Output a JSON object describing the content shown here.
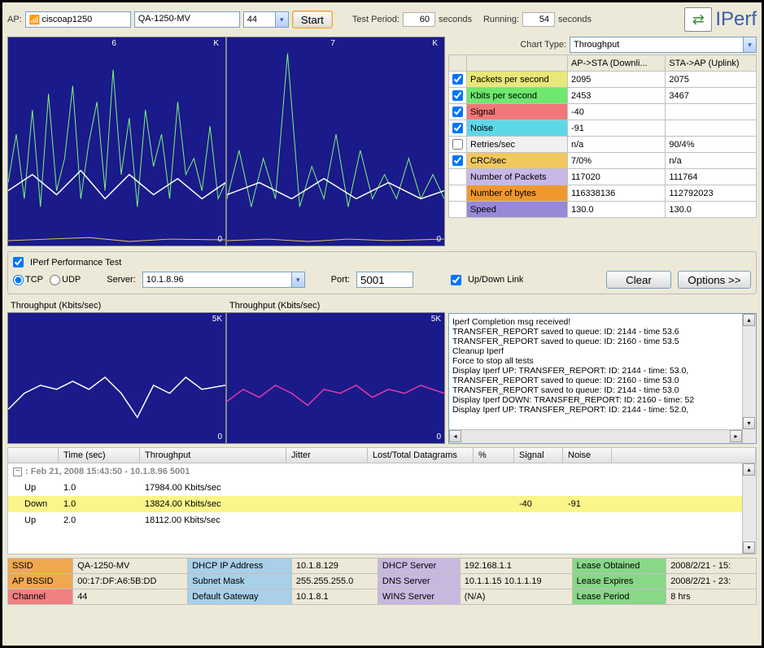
{
  "top": {
    "ap_label": "AP:",
    "ap_name": "ciscoap1250",
    "ap_ssid": "QA-1250-MV",
    "channel": "44",
    "start_btn": "Start",
    "test_period_label": "Test Period:",
    "test_period": "60",
    "seconds1": "seconds",
    "running_label": "Running:",
    "running": "54",
    "seconds2": "seconds",
    "logo": "IPerf"
  },
  "charts": {
    "main1": {
      "top": "6",
      "unit": "K",
      "bottom": "0"
    },
    "main2": {
      "top": "7",
      "unit": "K",
      "bottom": "0"
    }
  },
  "chart_type_label": "Chart Type:",
  "chart_type_value": "Throughput",
  "metrics": {
    "col1": "AP->STA (Downli...",
    "col2": "STA->AP (Uplink)",
    "rows": [
      {
        "chk": true,
        "label": "Packets per second",
        "v1": "2095",
        "v2": "2075"
      },
      {
        "chk": true,
        "label": "Kbits per second",
        "v1": "2453",
        "v2": "3467"
      },
      {
        "chk": true,
        "label": "Signal",
        "v1": "-40",
        "v2": ""
      },
      {
        "chk": true,
        "label": "Noise",
        "v1": "-91",
        "v2": ""
      },
      {
        "chk": false,
        "label": "Retries/sec",
        "v1": "n/a",
        "v2": "90/4%"
      },
      {
        "chk": true,
        "label": "CRC/sec",
        "v1": "7/0%",
        "v2": "n/a"
      },
      {
        "chk": null,
        "label": "Number of Packets",
        "v1": "117020",
        "v2": "111764"
      },
      {
        "chk": null,
        "label": "Number of bytes",
        "v1": "116338136",
        "v2": "112792023"
      },
      {
        "chk": null,
        "label": "Speed",
        "v1": "130.0",
        "v2": "130.0"
      }
    ]
  },
  "iperf": {
    "test_label": "IPerf Performance Test",
    "tcp": "TCP",
    "udp": "UDP",
    "server_label": "Server:",
    "server": "10.1.8.96",
    "port_label": "Port:",
    "port": "5001",
    "updown": "Up/Down Link",
    "clear": "Clear",
    "options": "Options >>"
  },
  "tp": {
    "label1": "Throughput (Kbits/sec)",
    "label2": "Throughput (Kbits/sec)",
    "max": "5K",
    "min": "0"
  },
  "log": {
    "lines": [
      "Iperf Completion msg received!",
      "TRANSFER_REPORT saved to queue: ID: 2144 - time 53.6",
      "TRANSFER_REPORT saved to queue: ID: 2160 - time 53.5",
      "Cleanup Iperf",
      "Force to stop all tests",
      "Display Iperf UP: TRANSFER_REPORT: ID: 2144 - time: 53.0,",
      "TRANSFER_REPORT saved to queue: ID: 2160 - time 53.0",
      "TRANSFER_REPORT saved to queue: ID: 2144 - time 53.0",
      "Display Iperf DOWN: TRANSFER_REPORT: ID: 2160 - time: 52",
      "Display Iperf UP: TRANSFER_REPORT: ID: 2144 - time: 52.0,"
    ]
  },
  "cols": [
    "",
    "Time (sec)",
    "Throughput",
    "Jitter",
    "Lost/Total Datagrams",
    "%",
    "Signal",
    "Noise",
    ""
  ],
  "session": ": Feb 21, 2008 15:43:50 - 10.1.8.96 5001",
  "results": [
    {
      "dir": "Up",
      "time": "1.0",
      "tp": "17984.00 Kbits/sec",
      "sig": "",
      "noise": ""
    },
    {
      "dir": "Down",
      "time": "1.0",
      "tp": "13824.00 Kbits/sec",
      "sig": "-40",
      "noise": "-91"
    },
    {
      "dir": "Up",
      "time": "2.0",
      "tp": "18112.00 Kbits/sec",
      "sig": "",
      "noise": ""
    }
  ],
  "info": {
    "r1": [
      "SSID",
      "QA-1250-MV",
      "DHCP IP Address",
      "10.1.8.129",
      "DHCP Server",
      "192.168.1.1",
      "Lease Obtained",
      "2008/2/21 - 15:"
    ],
    "r2": [
      "AP BSSID",
      "00:17:DF:A6:5B:DD",
      "Subnet Mask",
      "255.255.255.0",
      "DNS Server",
      "10.1.1.15 10.1.1.19",
      "Lease Expires",
      "2008/2/21 - 23:"
    ],
    "r3": [
      "Channel",
      "44",
      "Default Gateway",
      "10.1.8.1",
      "WINS Server",
      "(N/A)",
      "Lease Period",
      "8 hrs"
    ]
  },
  "chart_data": [
    {
      "type": "line",
      "title": "Downlink realtime metrics",
      "ylim": [
        0,
        6000
      ],
      "note": "spiky time-series, ~60 samples, peaks to ~6K, baseline ~2-3K"
    },
    {
      "type": "line",
      "title": "Uplink realtime metrics",
      "ylim": [
        0,
        7000
      ],
      "note": "spiky time-series, ~60 samples, one large spike to ~7K, baseline ~2-3K"
    },
    {
      "type": "line",
      "title": "Throughput down Kbits/sec",
      "ylim": [
        0,
        5000
      ],
      "note": "white line fluctuating 1K-3K"
    },
    {
      "type": "line",
      "title": "Throughput up Kbits/sec",
      "ylim": [
        0,
        5000
      ],
      "note": "magenta line fluctuating 1K-3K"
    }
  ]
}
